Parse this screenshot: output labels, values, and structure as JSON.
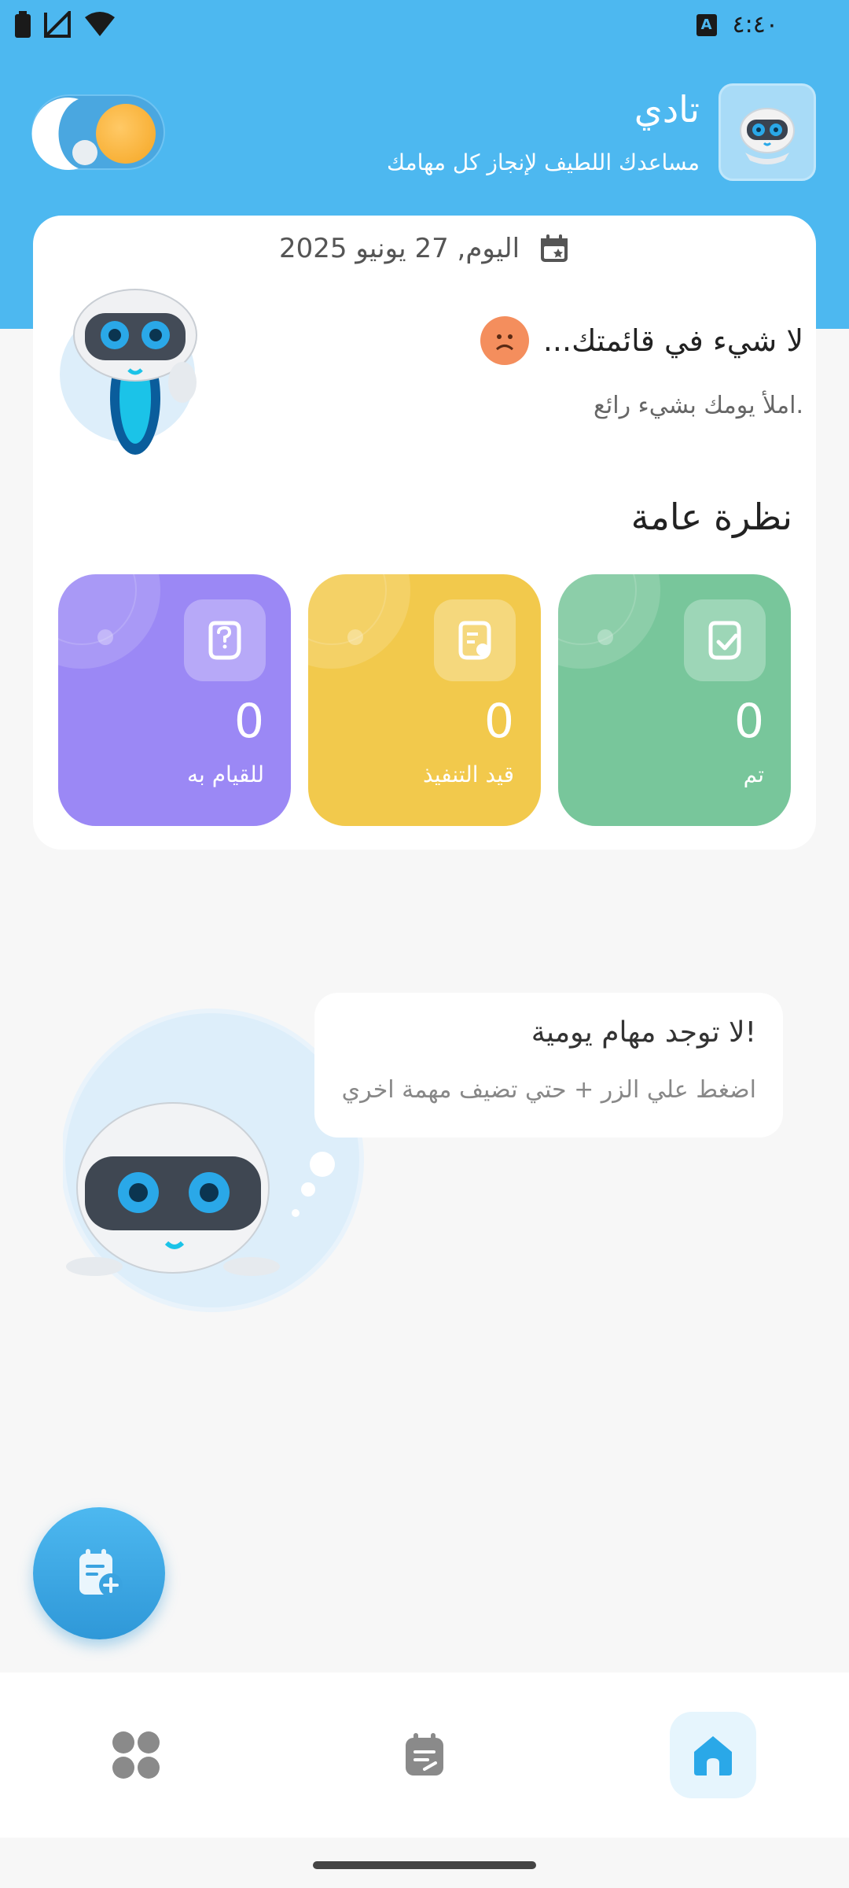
{
  "status_bar": {
    "time": "٤:٤٠",
    "notification_badge": "A"
  },
  "header": {
    "title": "تادي",
    "subtitle": "مساعدك اللطيف لإنجاز كل مهامك"
  },
  "today": {
    "date_label": "اليوم, 27 يونيو 2025"
  },
  "empty_list": {
    "title": "لا شيء في قائمتك...",
    "subtitle": "املأ يومك بشيء رائع."
  },
  "overview": {
    "title": "نظرة عامة",
    "cards": [
      {
        "label": "تم",
        "count": "0",
        "color": "#78c69b"
      },
      {
        "label": "قيد التنفيذ",
        "count": "0",
        "color": "#f2c94c"
      },
      {
        "label": "للقيام به",
        "count": "0",
        "color": "#9b88f5"
      }
    ]
  },
  "daily": {
    "title": "لا توجد مهام يومية!",
    "hint": "اضغط علي الزر + حتي تضيف مهمة اخري"
  },
  "colors": {
    "primary": "#4db8f0",
    "done": "#78c69b",
    "in_progress": "#f2c94c",
    "todo": "#9b88f5",
    "sad": "#f48e5d"
  },
  "nav": {
    "items": [
      "home-icon",
      "tasks-icon",
      "apps-icon"
    ],
    "active": "home-icon"
  }
}
